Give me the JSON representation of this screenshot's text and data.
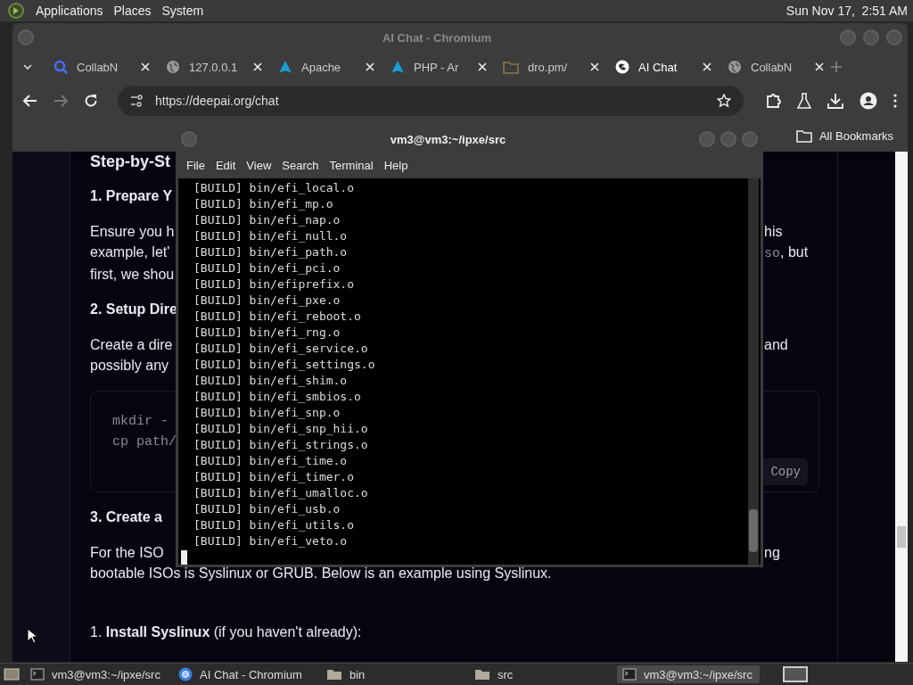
{
  "top_panel": {
    "menus": [
      "Applications",
      "Places",
      "System"
    ],
    "clock": "Sun Nov 17,  2:51 AM"
  },
  "browser": {
    "title": "AI Chat - Chromium",
    "tabs": [
      {
        "label": "CollabN",
        "kind": "search",
        "selected": false
      },
      {
        "label": "127.0.0.1",
        "kind": "globe",
        "selected": false
      },
      {
        "label": "Apache",
        "kind": "peak",
        "selected": false
      },
      {
        "label": "PHP - Ar",
        "kind": "peak",
        "selected": false
      },
      {
        "label": "dro.pm/",
        "kind": "folder",
        "selected": false
      },
      {
        "label": "AI Chat",
        "kind": "swirl",
        "selected": true
      },
      {
        "label": "CollabN",
        "kind": "globe",
        "selected": false
      }
    ],
    "url": "https://deepai.org/chat",
    "bookmarks_label": "All Bookmarks",
    "page": [
      {
        "kind": "title",
        "left": "Step-by-St"
      },
      {
        "kind": "heading",
        "left": "1. Prepare Y"
      },
      {
        "kind": "para",
        "lines": [
          {
            "left": "Ensure you h",
            "right": [
              {
                "kind": "text",
                "text": "his"
              }
            ]
          },
          {
            "left": "example, let'",
            "right": [
              {
                "kind": "code",
                "text": "so"
              },
              {
                "kind": "text",
                "text": ", but"
              }
            ]
          },
          {
            "left": "first, we shou"
          }
        ]
      },
      {
        "kind": "heading",
        "left": "2. Setup Dire"
      },
      {
        "kind": "para",
        "lines": [
          {
            "left": "Create a dire",
            "right": [
              {
                "kind": "text",
                "text": "and"
              }
            ]
          },
          {
            "left": "possibly any"
          }
        ]
      },
      {
        "kind": "code",
        "lines": [
          "mkdir -",
          "cp path/"
        ],
        "copy": "Copy"
      },
      {
        "kind": "heading",
        "left": "3. Create a"
      },
      {
        "kind": "para",
        "lines": [
          {
            "left": "For the ISO",
            "right": [
              {
                "kind": "text",
                "text": "ng"
              }
            ]
          },
          {
            "full": "bootable ISOs is Syslinux or GRUB. Below is an example using Syslinux."
          }
        ]
      },
      {
        "kind": "item",
        "full": "1. **Install Syslinux** (if you haven't already):"
      }
    ]
  },
  "terminal": {
    "title": "vm3@vm3:~/ipxe/src",
    "menus": [
      "File",
      "Edit",
      "View",
      "Search",
      "Terminal",
      "Help"
    ],
    "lines": [
      "[BUILD] bin/efi_local.o",
      "[BUILD] bin/efi_mp.o",
      "[BUILD] bin/efi_nap.o",
      "[BUILD] bin/efi_null.o",
      "[BUILD] bin/efi_path.o",
      "[BUILD] bin/efi_pci.o",
      "[BUILD] bin/efiprefix.o",
      "[BUILD] bin/efi_pxe.o",
      "[BUILD] bin/efi_reboot.o",
      "[BUILD] bin/efi_rng.o",
      "[BUILD] bin/efi_service.o",
      "[BUILD] bin/efi_settings.o",
      "[BUILD] bin/efi_shim.o",
      "[BUILD] bin/efi_smbios.o",
      "[BUILD] bin/efi_snp.o",
      "[BUILD] bin/efi_snp_hii.o",
      "[BUILD] bin/efi_strings.o",
      "[BUILD] bin/efi_time.o",
      "[BUILD] bin/efi_timer.o",
      "[BUILD] bin/efi_umalloc.o",
      "[BUILD] bin/efi_usb.o",
      "[BUILD] bin/efi_utils.o",
      "[BUILD] bin/efi_veto.o"
    ]
  },
  "taskbar": {
    "items": [
      {
        "label": "vm3@vm3:~/ipxe/src",
        "kind": "terminal",
        "selected": false
      },
      {
        "label": "AI Chat - Chromium",
        "kind": "browser",
        "selected": false
      },
      {
        "label": "bin",
        "kind": "folder",
        "selected": false
      },
      {
        "label": "src",
        "kind": "folder",
        "selected": false
      },
      {
        "label": "vm3@vm3:~/ipxe/src",
        "kind": "terminal",
        "selected": true
      }
    ]
  }
}
